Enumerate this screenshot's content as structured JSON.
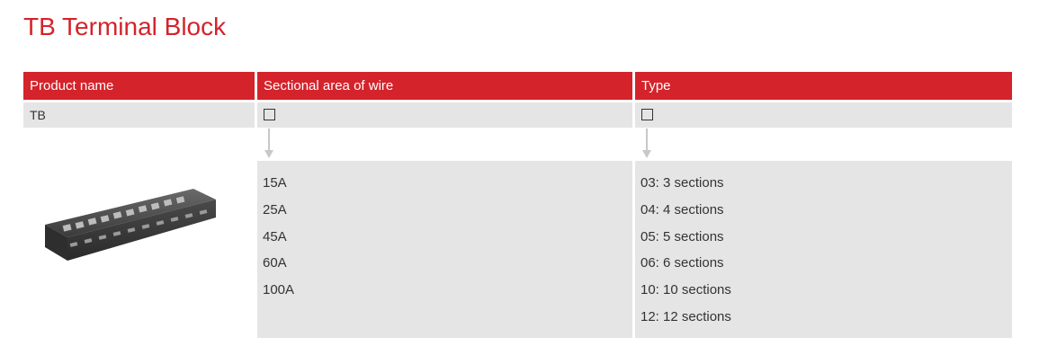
{
  "page": {
    "title": "TB Terminal Block"
  },
  "table": {
    "headers": [
      "Product name",
      "Sectional area of wire",
      "Type"
    ],
    "product_row": {
      "name": "TB"
    },
    "wire_options": [
      "15A",
      "25A",
      "45A",
      "60A",
      "100A"
    ],
    "type_options": [
      "03: 3 sections",
      "04: 4 sections",
      "05: 5 sections",
      "06: 6 sections",
      "10: 10 sections",
      "12: 12 sections"
    ]
  },
  "colors": {
    "accent": "#d4232b",
    "cell_bg": "#e5e5e5"
  }
}
